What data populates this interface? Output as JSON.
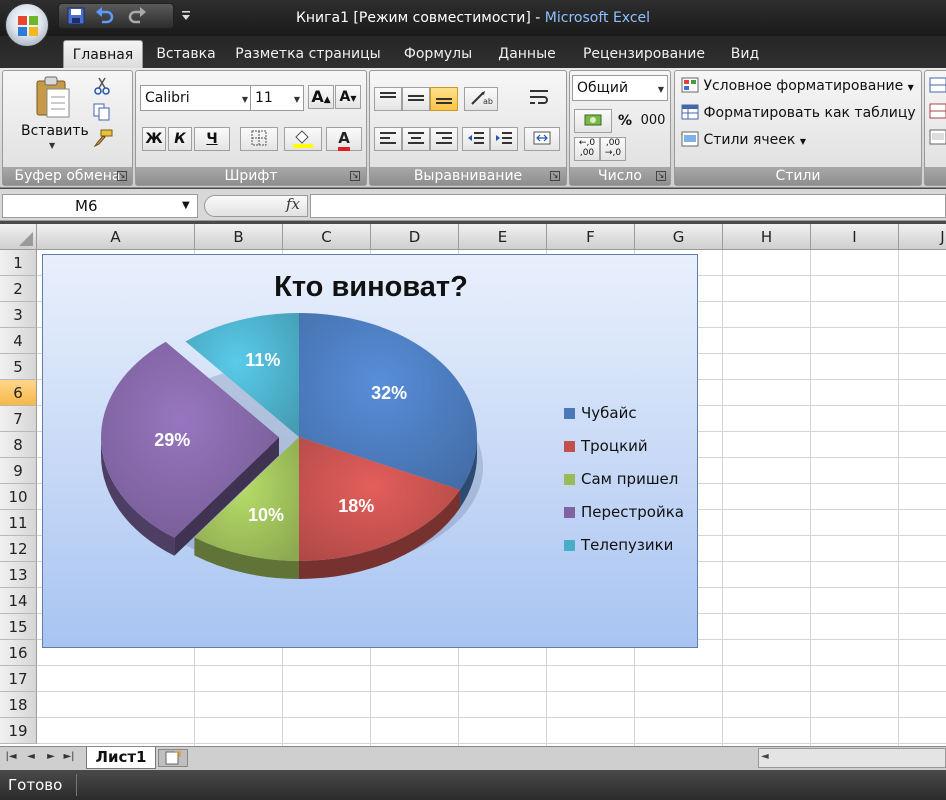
{
  "window": {
    "title_doc": "Книга1  [Режим совместимости] - ",
    "title_app": "Microsoft Excel"
  },
  "ribbon_tabs": [
    "Главная",
    "Вставка",
    "Разметка страницы",
    "Формулы",
    "Данные",
    "Рецензирование",
    "Вид"
  ],
  "clipboard": {
    "label": "Буфер обмена",
    "paste": "Вставить"
  },
  "font": {
    "label": "Шрифт",
    "name": "Calibri",
    "size": "11",
    "bold": "Ж",
    "italic": "К",
    "underline": "Ч"
  },
  "alignment": {
    "label": "Выравнивание"
  },
  "number": {
    "label": "Число",
    "format": "Общий",
    "percent": "%",
    "thousands": "000"
  },
  "styles": {
    "label": "Стили",
    "conditional": "Условное форматирование",
    "format_table": "Форматировать как таблицу",
    "cell_styles": "Стили ячеек"
  },
  "formula_bar": {
    "name_box": "M6",
    "fx": "fx",
    "content": ""
  },
  "columns": [
    "A",
    "B",
    "C",
    "D",
    "E",
    "F",
    "G",
    "H",
    "I",
    "J"
  ],
  "rows": [
    "1",
    "2",
    "3",
    "4",
    "5",
    "6",
    "7",
    "8",
    "9",
    "10",
    "11",
    "12",
    "13",
    "14",
    "15",
    "16",
    "17",
    "18",
    "19"
  ],
  "selected_row": "6",
  "sheet_tabs": [
    "Лист1"
  ],
  "status": "Готово",
  "chart_data": {
    "type": "pie",
    "title": "Кто виноват?",
    "categories": [
      "Чубайс",
      "Троцкий",
      "Сам пришел",
      "Перестройка",
      "Телепузики"
    ],
    "values": [
      32,
      18,
      10,
      29,
      11
    ],
    "labels": [
      "32%",
      "18%",
      "10%",
      "29%",
      "11%"
    ],
    "colors": [
      "#4a78b8",
      "#c0504d",
      "#9bbb59",
      "#8064a2",
      "#4bacc6"
    ],
    "exploded": [
      "Перестройка"
    ],
    "legend_position": "right",
    "style": "3d"
  }
}
